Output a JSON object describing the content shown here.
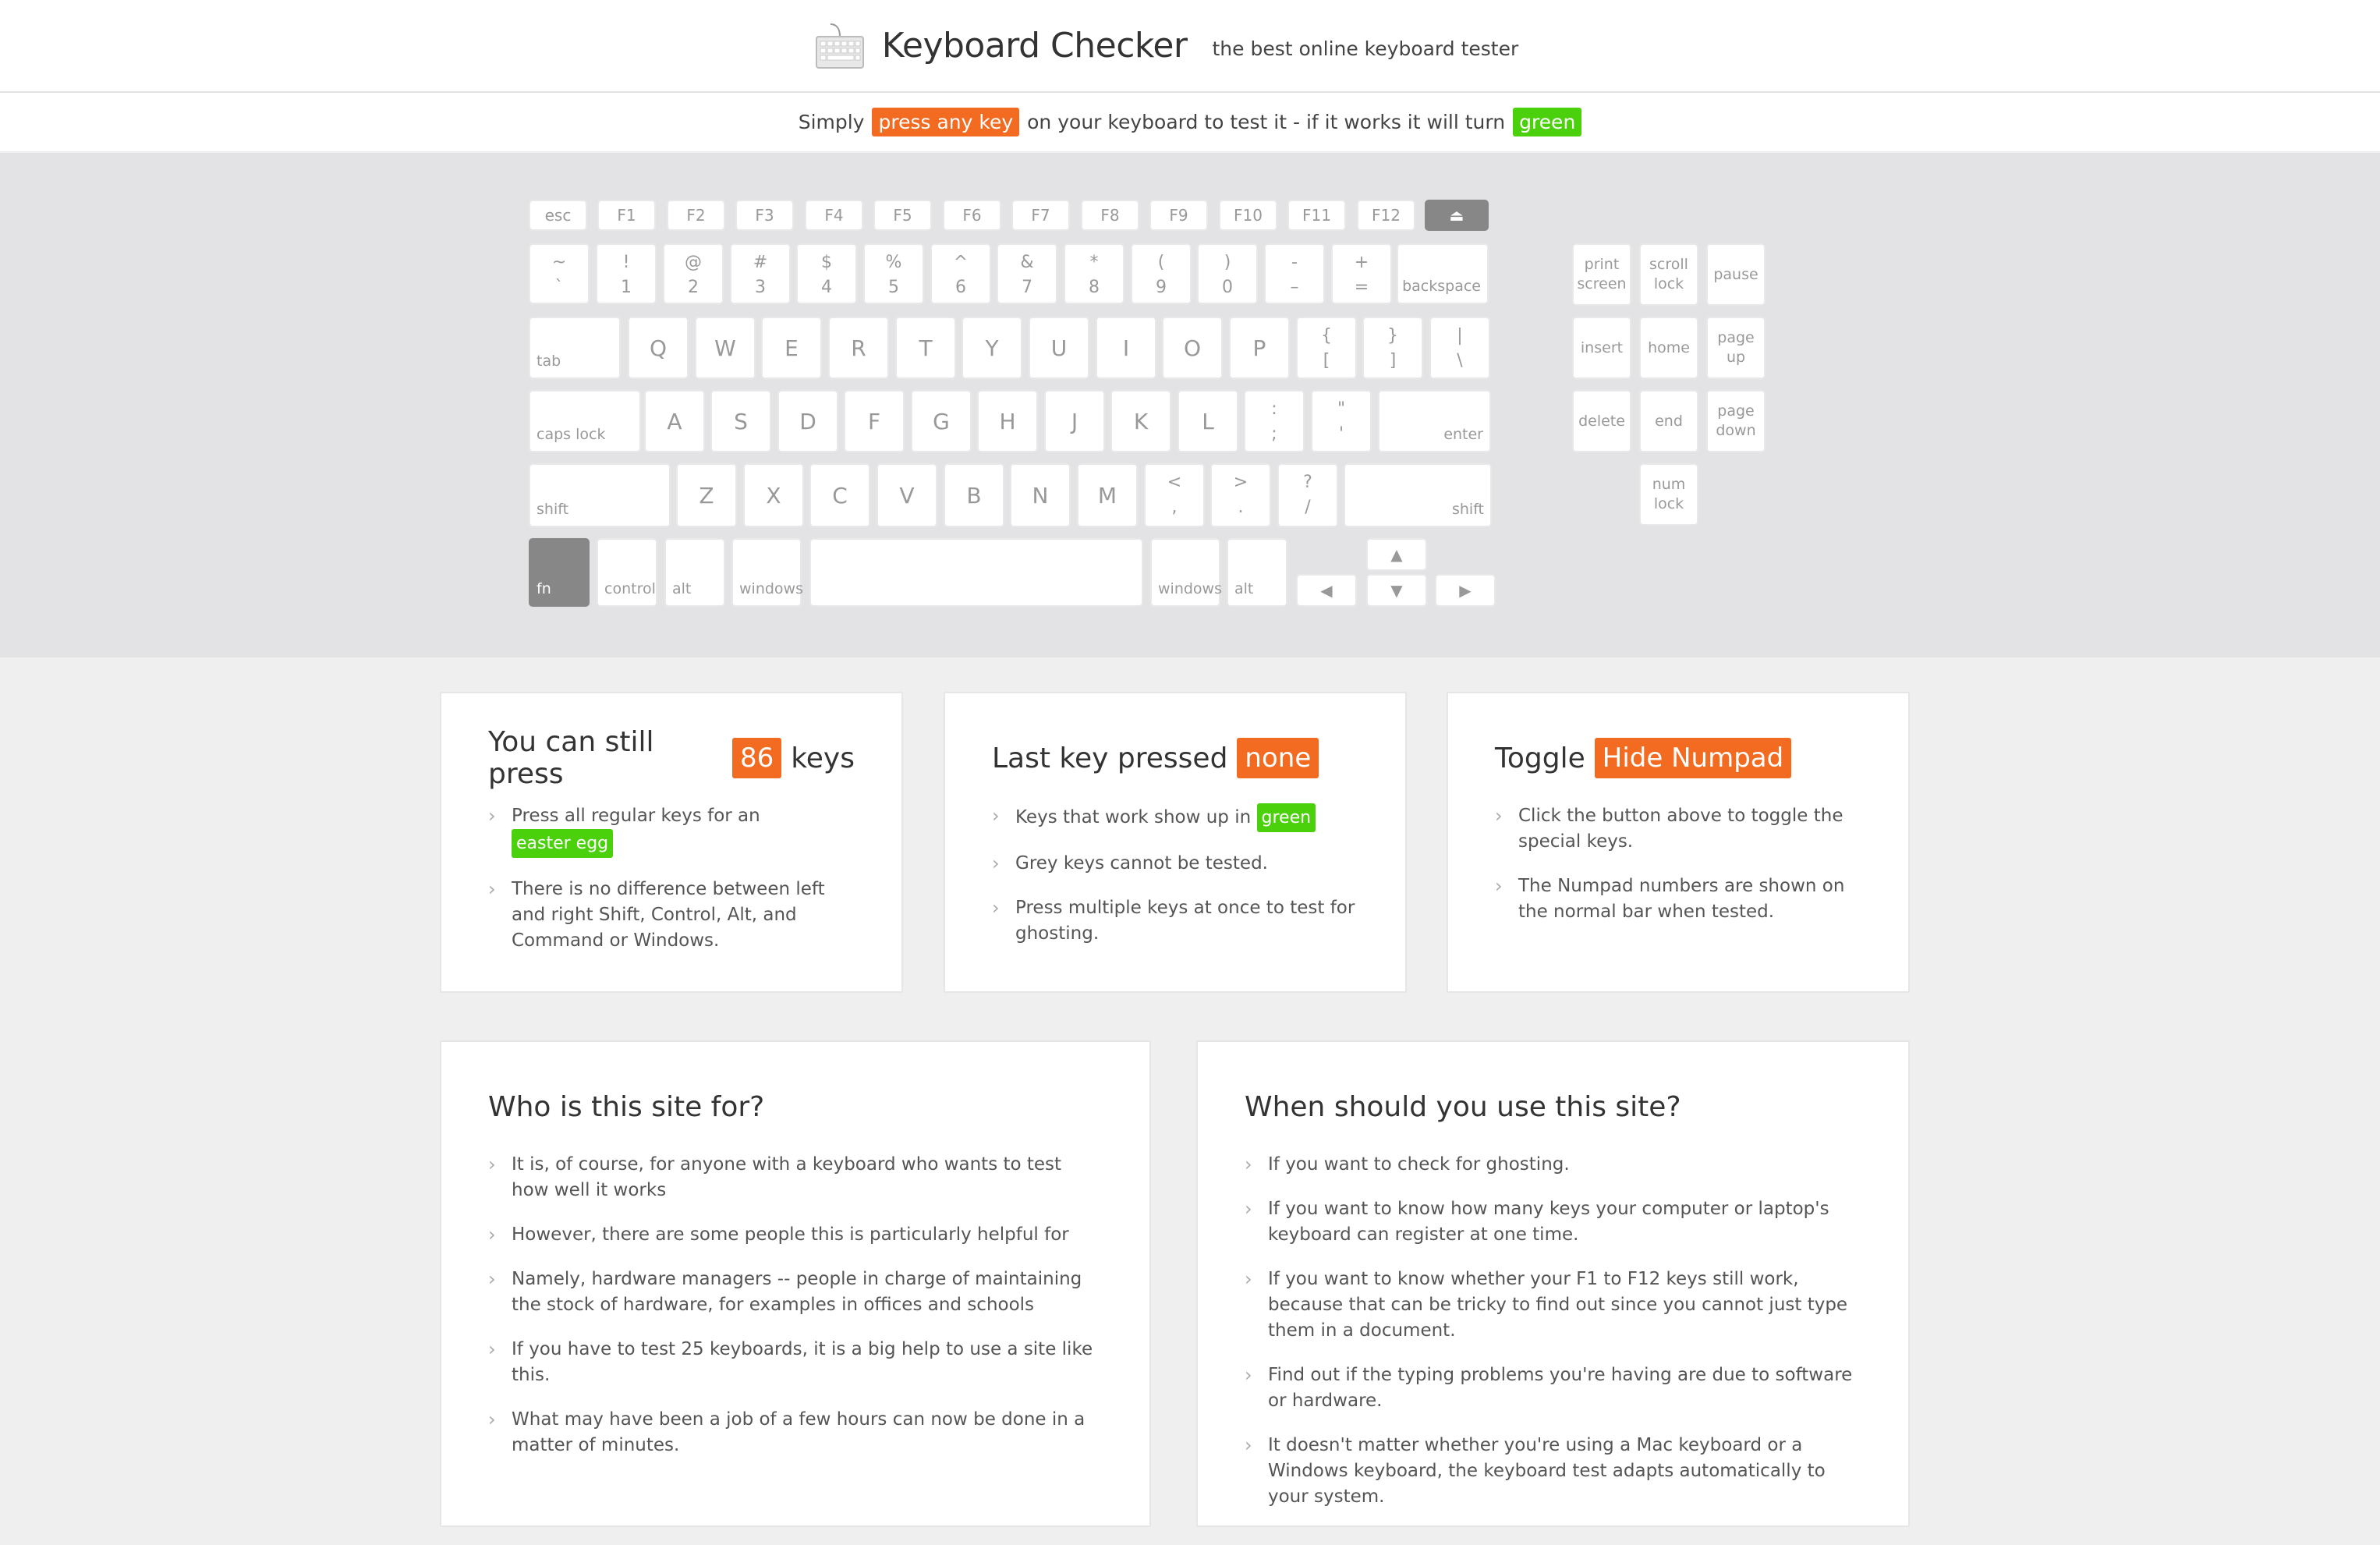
{
  "header": {
    "title": "Keyboard Checker",
    "subtitle": "the best online keyboard tester"
  },
  "instruction": {
    "prefix": "Simply",
    "press_tag": "press any key",
    "middle": "on your keyboard to test it - if it works it will turn",
    "green_tag": "green"
  },
  "colors": {
    "orange": "#f26b21",
    "green": "#4bd10b",
    "key_grey": "#878787"
  },
  "keyboard": {
    "frow": [
      "esc",
      "F1",
      "F2",
      "F3",
      "F4",
      "F5",
      "F6",
      "F7",
      "F8",
      "F9",
      "F10",
      "F11",
      "F12",
      "⏏"
    ],
    "numrow": [
      [
        "~",
        "`"
      ],
      [
        "!",
        "1"
      ],
      [
        "@",
        "2"
      ],
      [
        "#",
        "3"
      ],
      [
        "$",
        "4"
      ],
      [
        "%",
        "5"
      ],
      [
        "^",
        "6"
      ],
      [
        "&",
        "7"
      ],
      [
        "*",
        "8"
      ],
      [
        "(",
        "9"
      ],
      [
        ")",
        "0"
      ],
      [
        "-",
        "–"
      ],
      [
        "+",
        "="
      ]
    ],
    "backspace": "backspace",
    "tab": "tab",
    "qrow": [
      "Q",
      "W",
      "E",
      "R",
      "T",
      "Y",
      "U",
      "I",
      "O",
      "P"
    ],
    "qrow_sym": [
      [
        "{",
        "["
      ],
      [
        "}",
        "]"
      ],
      [
        "|",
        "\\"
      ]
    ],
    "capslock": "caps lock",
    "arow": [
      "A",
      "S",
      "D",
      "F",
      "G",
      "H",
      "J",
      "K",
      "L"
    ],
    "arow_sym": [
      [
        ":",
        ";"
      ],
      [
        "\"",
        "'"
      ]
    ],
    "enter": "enter",
    "shift_left": "shift",
    "zrow": [
      "Z",
      "X",
      "C",
      "V",
      "B",
      "N",
      "M"
    ],
    "zrow_sym": [
      [
        "<",
        ","
      ],
      [
        ">",
        "."
      ],
      [
        "?",
        "/"
      ]
    ],
    "shift_right": "shift",
    "bottom": {
      "fn": "fn",
      "control": "control",
      "alt": "alt",
      "windows": "windows",
      "windows_r": "windows",
      "alt_r": "alt"
    },
    "arrows": {
      "up": "▲",
      "left": "◀",
      "down": "▼",
      "right": "▶"
    },
    "sys": [
      [
        "print",
        "screen"
      ],
      [
        "scroll",
        "lock"
      ],
      [
        "pause"
      ],
      [
        "insert"
      ],
      [
        "home"
      ],
      [
        "page",
        "up"
      ],
      [
        "delete"
      ],
      [
        "end"
      ],
      [
        "page",
        "down"
      ],
      [
        "num",
        "lock"
      ]
    ]
  },
  "cards": {
    "remaining": {
      "title_pre": "You can still press",
      "count": "86",
      "title_post": "keys",
      "items": [
        {
          "text": "Press all regular keys for an",
          "tag": "easter egg"
        },
        {
          "text": "There is no difference between left and right Shift, Control, Alt, and Command or Windows."
        }
      ]
    },
    "last": {
      "title_pre": "Last key pressed",
      "value": "none",
      "items": [
        {
          "text": "Keys that work show up in",
          "tag": "green"
        },
        {
          "text": "Grey keys cannot be tested."
        },
        {
          "text": "Press multiple keys at once to test for ghosting."
        }
      ]
    },
    "toggle": {
      "title_pre": "Toggle",
      "button": "Hide Numpad",
      "items": [
        {
          "text": "Click the button above to toggle the special keys."
        },
        {
          "text": "The Numpad numbers are shown on the normal bar when tested."
        }
      ]
    },
    "who": {
      "title": "Who is this site for?",
      "items": [
        "It is, of course, for anyone with a keyboard who wants to test how well it works",
        "However, there are some people this is particularly helpful for",
        "Namely, hardware managers -- people in charge of maintaining the stock of hardware, for examples in offices and schools",
        "If you have to test 25 keyboards, it is a big help to use a site like this.",
        "What may have been a job of a few hours can now be done in a matter of minutes."
      ]
    },
    "when": {
      "title": "When should you use this site?",
      "items": [
        "If you want to check for ghosting.",
        "If you want to know how many keys your computer or laptop's keyboard can register at one time.",
        "If you want to know whether your F1 to F12 keys still work, because that can be tricky to find out since you cannot just type them in a document.",
        "Find out if the typing problems you're having are due to software or hardware.",
        "It doesn't matter whether you're using a Mac keyboard or a Windows keyboard, the keyboard test adapts automatically to your system."
      ]
    }
  }
}
